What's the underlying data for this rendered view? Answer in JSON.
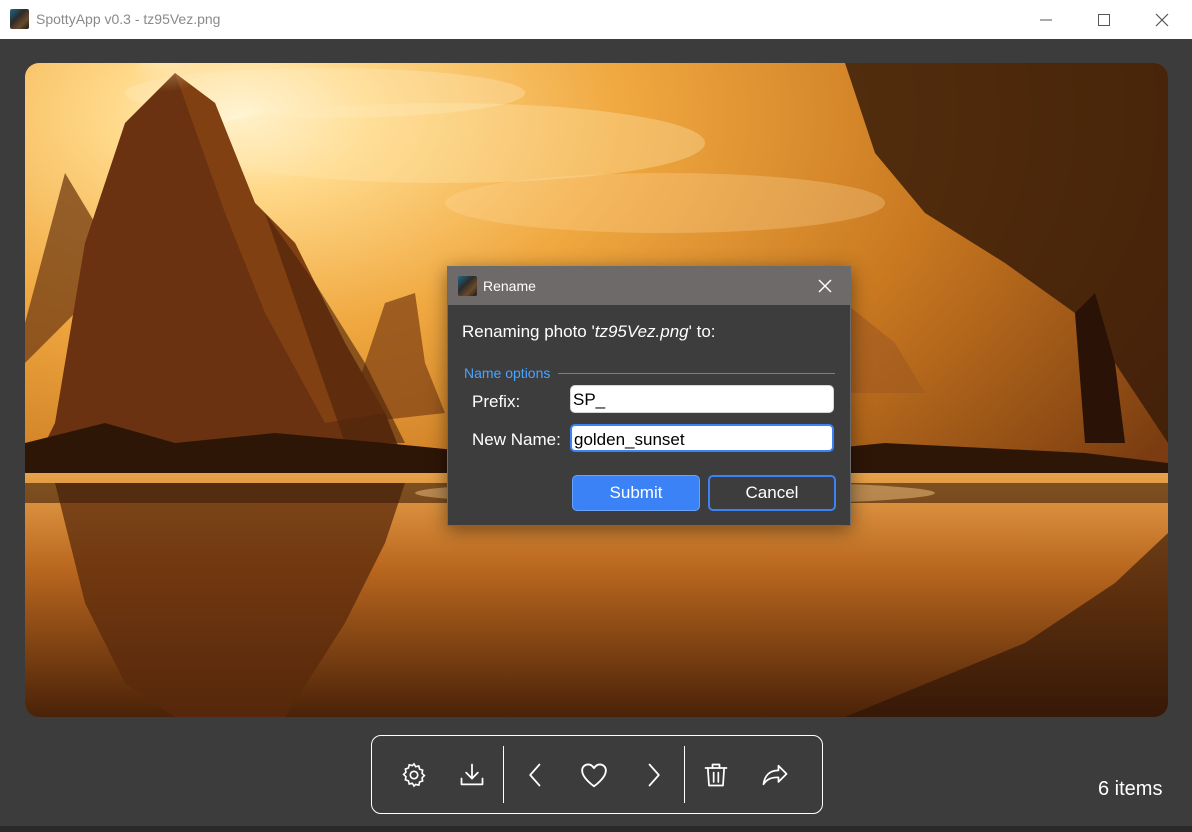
{
  "window": {
    "title": "SpottyApp v0.3 - tz95Vez.png",
    "app_icon": "spotty-app-icon",
    "controls": [
      "minimize-icon",
      "maximize-icon",
      "close-icon"
    ]
  },
  "photo": {
    "subject": "golden sunset over karst mountains and river"
  },
  "dialog": {
    "title": "Rename",
    "prompt_prefix": "Renaming photo '",
    "prompt_file": "tz95Vez.png",
    "prompt_suffix": "' to:",
    "group_label": "Name options",
    "prefix_label": "Prefix:",
    "prefix_value": "SP_",
    "newname_label": "New Name:",
    "newname_value": "golden_sunset",
    "submit_label": "Submit",
    "cancel_label": "Cancel"
  },
  "toolbar": {
    "buttons": [
      "gear-icon",
      "download-icon",
      "chevron-left-icon",
      "heart-icon",
      "chevron-right-icon",
      "trash-icon",
      "share-icon"
    ]
  },
  "status": {
    "items_count": "6 items"
  },
  "colors": {
    "accent": "#3b82f6",
    "legend": "#4aa3ff",
    "background": "#3c3c3c",
    "dialog_titlebar": "#6e6a69"
  }
}
